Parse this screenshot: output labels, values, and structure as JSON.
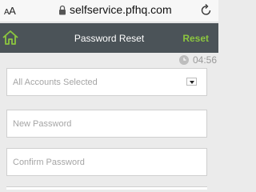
{
  "browser": {
    "text_size_large": "A",
    "text_size_small": "A",
    "url": "selfservice.pfhq.com"
  },
  "header": {
    "title": "Password Reset",
    "reset_label": "Reset"
  },
  "timer": {
    "value": "04:56"
  },
  "form": {
    "accounts_selected": "All Accounts Selected",
    "new_password_placeholder": "New Password",
    "confirm_password_placeholder": "Confirm Password"
  },
  "colors": {
    "header_bg": "#4b5358",
    "accent": "#8cc63f",
    "page_bg": "#ebebeb"
  },
  "icons": {
    "browser": [
      "lock-icon",
      "reload-icon"
    ],
    "header": [
      "home-icon"
    ],
    "timer": [
      "clock-icon"
    ]
  }
}
